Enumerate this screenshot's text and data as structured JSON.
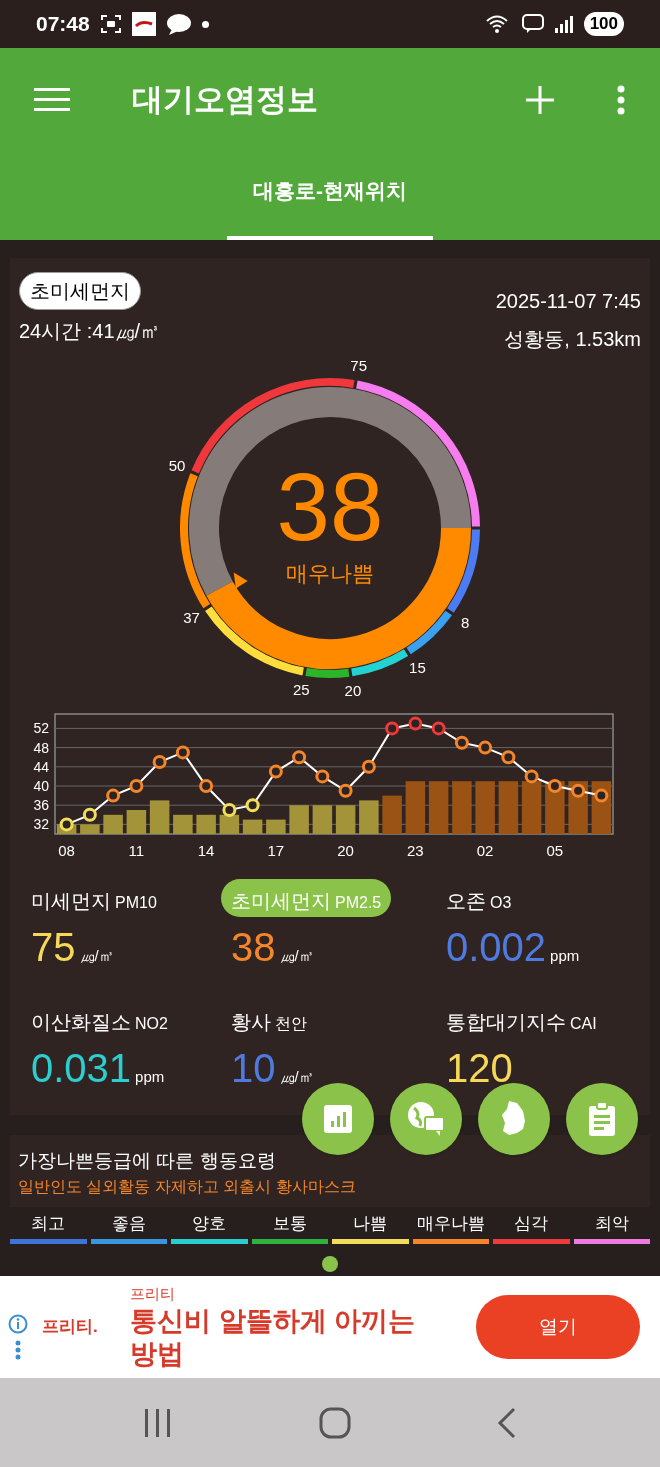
{
  "status_bar": {
    "time": "07:48",
    "battery": "100"
  },
  "app_bar": {
    "title": "대기오염정보"
  },
  "tabs": [
    {
      "label": "대흥로-현재위치",
      "selected": true
    }
  ],
  "card": {
    "pollutant_chip": "초미세먼지",
    "average": "24시간 :41㎍/㎥",
    "datetime": "2025-11-07 7:45",
    "station": "성황동, 1.53km"
  },
  "gauge": {
    "value": "38",
    "grade": "매우나쁨",
    "ticks": [
      "8",
      "15",
      "20",
      "25",
      "37",
      "50",
      "75"
    ]
  },
  "chart_data": {
    "type": "bar",
    "stacked": false,
    "grid": true,
    "categories": [
      "08",
      null,
      null,
      "11",
      null,
      null,
      "14",
      null,
      null,
      "17",
      null,
      null,
      "20",
      null,
      null,
      "23",
      null,
      null,
      "02",
      null,
      null,
      "05",
      null,
      null
    ],
    "yticks": [
      32,
      36,
      40,
      44,
      48,
      52
    ],
    "ylim": [
      30,
      55
    ],
    "series": [
      {
        "type": "bar",
        "colors": [
          "#a39339",
          "#a39339",
          "#a39339",
          "#a39339",
          "#a39339",
          "#a39339",
          "#a39339",
          "#a39339",
          "#a39339",
          "#a39339",
          "#a39339",
          "#a39339",
          "#a39339",
          "#a39339",
          "#9a5215",
          "#9a5215",
          "#9a5215",
          "#9a5215",
          "#9a5215",
          "#9a5215",
          "#9a5215",
          "#9a5215",
          "#9a5215",
          "#9a5215"
        ],
        "values": [
          32,
          32,
          34,
          35,
          37,
          34,
          34,
          34,
          33,
          33,
          36,
          36,
          36,
          37,
          38,
          41,
          41,
          41,
          41,
          41,
          41,
          41,
          41,
          41
        ]
      },
      {
        "type": "line",
        "color": "#ffffff",
        "marker": "circle",
        "values": [
          32,
          34,
          38,
          40,
          45,
          47,
          40,
          35,
          36,
          43,
          46,
          42,
          39,
          44,
          52,
          53,
          52,
          49,
          48,
          46,
          42,
          40,
          39,
          38
        ]
      }
    ]
  },
  "measurements": [
    {
      "name": "미세먼지",
      "code": "PM10",
      "value": "75",
      "unit": "㎍/㎥",
      "color": "#f7d95a",
      "selected": false
    },
    {
      "name": "초미세먼지",
      "code": "PM2.5",
      "value": "38",
      "unit": "㎍/㎥",
      "color": "#f5872a",
      "selected": true
    },
    {
      "name": "오존",
      "code": "O3",
      "value": "0.002",
      "unit": "ppm",
      "color": "#4f7be0",
      "selected": false
    },
    {
      "name": "이산화질소",
      "code": "NO2",
      "value": "0.031",
      "unit": "ppm",
      "color": "#2ccfcf",
      "selected": false
    },
    {
      "name": "황사",
      "code": "천안",
      "value": "10",
      "unit": "㎍/㎥",
      "color": "#4f7be0",
      "selected": false
    },
    {
      "name": "통합대기지수",
      "code": "CAI",
      "value": "120",
      "color": "#f7d95a",
      "selected": false
    }
  ],
  "fab_buttons": [
    {
      "kind": "chart"
    },
    {
      "kind": "globe"
    },
    {
      "kind": "map"
    },
    {
      "kind": "clipboard"
    }
  ],
  "advice": {
    "title": "가장나쁜등급에 따른 행동요령",
    "text": "일반인도 실외활동 자제하고 외출시 황사마스크"
  },
  "grades": [
    {
      "label": "최고",
      "color": "#3f73d8"
    },
    {
      "label": "좋음",
      "color": "#3a95e0"
    },
    {
      "label": "양호",
      "color": "#27cccc"
    },
    {
      "label": "보통",
      "color": "#2db33e"
    },
    {
      "label": "나쁨",
      "color": "#f2dd5a"
    },
    {
      "label": "매우나쁨",
      "color": "#f5852a"
    },
    {
      "label": "심각",
      "color": "#ee3a3a"
    },
    {
      "label": "최악",
      "color": "#f07be0"
    }
  ],
  "ad": {
    "logo": "프리티.",
    "advertiser": "프리티",
    "headline": "통신비 알뜰하게 아끼는 방법",
    "button": "열기"
  }
}
